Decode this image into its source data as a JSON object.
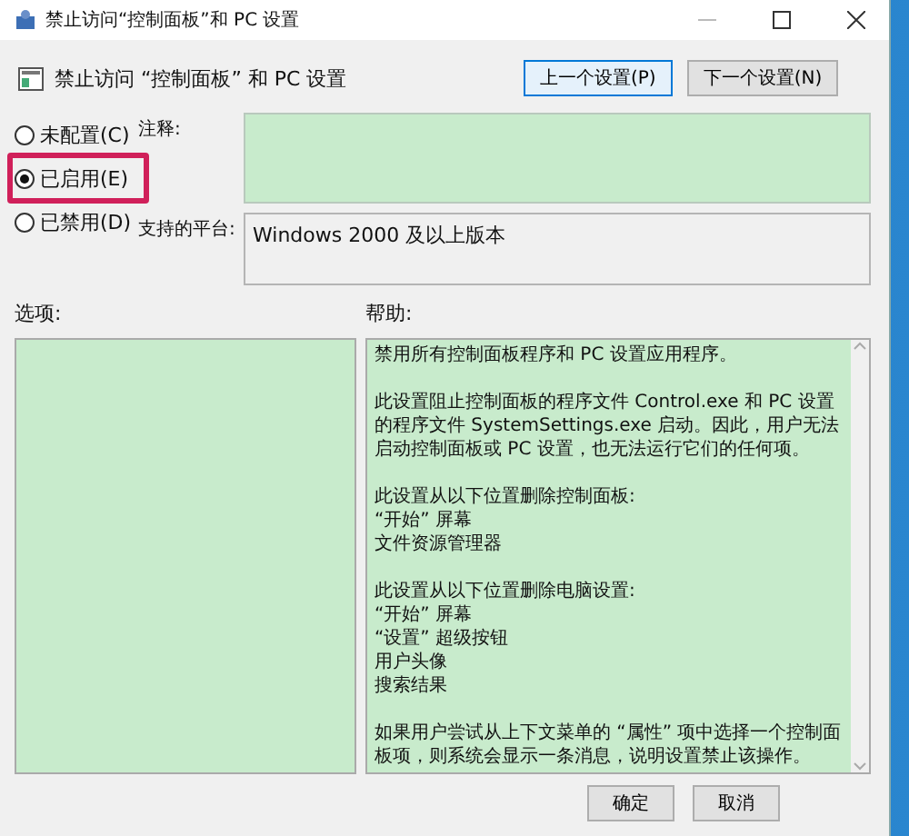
{
  "window": {
    "title": "禁止访问“控制面板”和 PC 设置"
  },
  "header": {
    "title": "禁止访问 “控制面板” 和 PC 设置",
    "buttons": [
      {
        "label": "上一个设置(P)",
        "focused": true
      },
      {
        "label": "下一个设置(N)",
        "focused": false
      }
    ]
  },
  "state_options": [
    {
      "label": "未配置(C)",
      "selected": false,
      "highlighted": false
    },
    {
      "label": "已启用(E)",
      "selected": true,
      "highlighted": true
    },
    {
      "label": "已禁用(D)",
      "selected": false,
      "highlighted": false
    }
  ],
  "comment": {
    "label": "注释:"
  },
  "platform": {
    "label": "支持的平台:",
    "value": "Windows 2000 及以上版本"
  },
  "options": {
    "label": "选项:"
  },
  "help": {
    "label": "帮助:",
    "blocks": [
      [
        "禁用所有控制面板程序和 PC 设置应用程序。"
      ],
      [
        "此设置阻止控制面板的程序文件 Control.exe 和 PC 设置的程序文件 SystemSettings.exe 启动。因此，用户无法启动控制面板或 PC 设置，也无法运行它们的任何项。"
      ],
      [
        "此设置从以下位置删除控制面板:",
        "“开始” 屏幕",
        "文件资源管理器"
      ],
      [
        "此设置从以下位置删除电脑设置:",
        "“开始” 屏幕",
        "“设置” 超级按钮",
        "用户头像",
        "搜索结果"
      ],
      [
        "如果用户尝试从上下文菜单的 “属性” 项中选择一个控制面板项，则系统会显示一条消息，说明设置禁止该操作。"
      ]
    ]
  },
  "buttons": [
    "确定",
    "取消"
  ]
}
